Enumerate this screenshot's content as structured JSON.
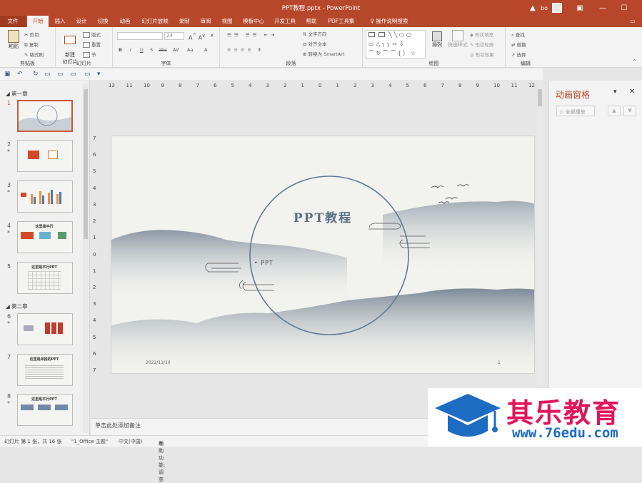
{
  "window": {
    "title": "PPT教程.pptx - PowerPoint",
    "warning_icon": "warning-icon",
    "user": "bo"
  },
  "tabs": [
    "文件",
    "开始",
    "插入",
    "设计",
    "切换",
    "动画",
    "幻灯片放映",
    "录制",
    "审阅",
    "视图",
    "模板中心",
    "开发工具",
    "帮助",
    "PDF工具集"
  ],
  "tell_me": "操作说明搜索",
  "ribbon": {
    "clipboard": {
      "label": "剪贴板",
      "paste": "粘贴",
      "cut": "剪切",
      "copy": "复制",
      "format_painter": "格式刷"
    },
    "slides": {
      "label": "幻灯片",
      "new_slide": "新建\n幻灯片",
      "layout": "版式",
      "reset": "重置",
      "section": "节"
    },
    "font": {
      "label": "字体",
      "size": "24",
      "bold": "B",
      "italic": "I",
      "underline": "U",
      "strike": "S",
      "spacing": "abc",
      "aa": "Aa",
      "color": "A"
    },
    "paragraph": {
      "label": "段落",
      "text_direction": "文字方向",
      "align_text": "对齐文本",
      "smartart": "转换为 SmartArt"
    },
    "drawing": {
      "label": "绘图",
      "arrange": "排列",
      "quick_styles": "快速样式",
      "fill": "形状填充",
      "outline": "形状轮廓",
      "effects": "形状效果"
    },
    "editing": {
      "label": "编辑",
      "find": "查找",
      "replace": "替换",
      "select": "选择"
    }
  },
  "sections": [
    "第一章",
    "第二章"
  ],
  "thumbnails": [
    {
      "num": "1",
      "star": ""
    },
    {
      "num": "2",
      "star": "*"
    },
    {
      "num": "3",
      "star": "*"
    },
    {
      "num": "4",
      "star": "*"
    },
    {
      "num": "5",
      "star": ""
    },
    {
      "num": "6",
      "star": "*"
    },
    {
      "num": "7",
      "star": ""
    },
    {
      "num": "8",
      "star": "*"
    }
  ],
  "thumb_text": {
    "t4": "这里是平行",
    "t5": "这里是平行PPT",
    "t7": "这里是单独的PPT",
    "t8": "这里是平行PPT"
  },
  "ruler_h": [
    "12",
    "11",
    "10",
    "9",
    "8",
    "7",
    "6",
    "5",
    "4",
    "3",
    "2",
    "1",
    "0",
    "1",
    "2",
    "3",
    "4",
    "5",
    "6",
    "7",
    "8",
    "9",
    "10",
    "11",
    "12"
  ],
  "ruler_v": [
    "7",
    "6",
    "5",
    "4",
    "3",
    "2",
    "1",
    "0",
    "1",
    "2",
    "3",
    "4",
    "5",
    "6",
    "7"
  ],
  "slide": {
    "title": "PPT教程",
    "subtitle": "• PPT",
    "date": "2022/11/10",
    "page": "1"
  },
  "notes_placeholder": "单击此处添加备注",
  "anim_pane": {
    "title": "动画窗格",
    "play_all": "全部播放"
  },
  "status": {
    "slide_info": "幻灯片 第 1 张，共 16 张",
    "theme": "\"1_Office 主题\"",
    "language": "中文(中国)",
    "accessibility": "辅助功能: 调查"
  },
  "watermark": {
    "brand": "其乐教育",
    "url": "www.76edu.com"
  },
  "colors": {
    "accent": "#b7472a",
    "slide_ink": "#5f7a95"
  }
}
